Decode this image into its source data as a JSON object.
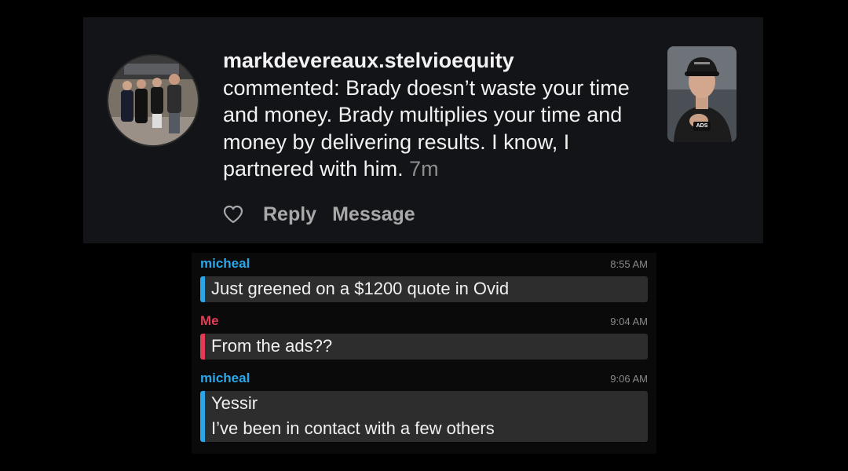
{
  "colors": {
    "card_bg": "#121418",
    "chat_bg": "#0a0a0a",
    "bubble_bg": "#2d2d2d",
    "other_accent": "#2aa6ea",
    "me_accent": "#e33d55"
  },
  "comment": {
    "username": "markdevereaux.stelvioequity",
    "text": "commented: Brady doesn’t waste your time and money.  Brady multiplies your time and money by delivering results. I know, I partnered with him.",
    "time": "7m",
    "avatar_icon": "group-photo-avatar",
    "thumbnail_icon": "video-thumbnail",
    "thumbnail_badge": "ADS",
    "actions": {
      "like_icon": "heart-icon",
      "reply": "Reply",
      "message": "Message"
    }
  },
  "chat": {
    "messages": [
      {
        "sender": "micheal",
        "time": "8:55 AM",
        "lines": [
          "Just greened on a $1200 quote in Ovid"
        ]
      },
      {
        "sender": "Me",
        "time": "9:04 AM",
        "lines": [
          "From the ads??"
        ]
      },
      {
        "sender": "micheal",
        "time": "9:06 AM",
        "lines": [
          "Yessir",
          "I’ve been in contact with a few others"
        ]
      }
    ]
  }
}
